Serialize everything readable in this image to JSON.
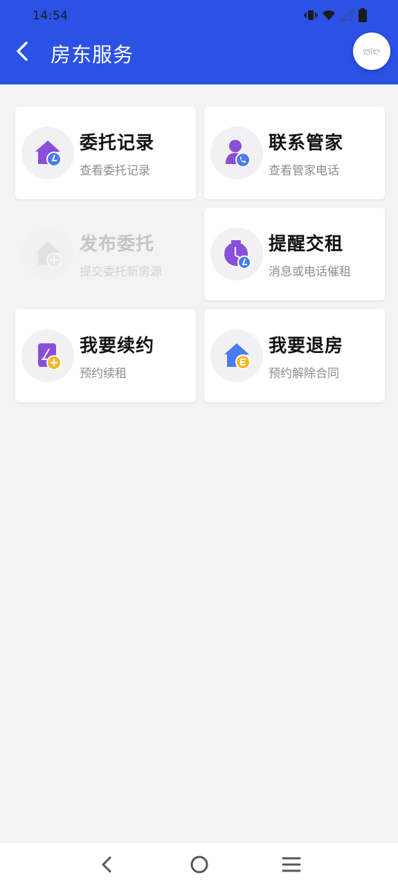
{
  "status_bar": {
    "time": "14:54"
  },
  "header": {
    "title": "房东服务",
    "float_button_text": "ლ|ლ"
  },
  "cards": [
    {
      "title": "委托记录",
      "subtitle": "查看委托记录",
      "icon": "house-clock-icon",
      "enabled": true
    },
    {
      "title": "联系管家",
      "subtitle": "查看管家电话",
      "icon": "person-phone-icon",
      "enabled": true
    },
    {
      "title": "发布委托",
      "subtitle": "提交委托新房源",
      "icon": "house-plus-icon",
      "enabled": false
    },
    {
      "title": "提醒交租",
      "subtitle": "消息或电话催租",
      "icon": "alarm-clock-icon",
      "enabled": true
    },
    {
      "title": "我要续约",
      "subtitle": "预约续租",
      "icon": "document-plus-icon",
      "enabled": true
    },
    {
      "title": "我要退房",
      "subtitle": "预约解除合同",
      "icon": "house-exit-icon",
      "enabled": true
    }
  ],
  "colors": {
    "header": "#2b51e5",
    "purple": "#8a4fd8",
    "blue": "#4a7cf0",
    "yellow": "#f2b824"
  }
}
